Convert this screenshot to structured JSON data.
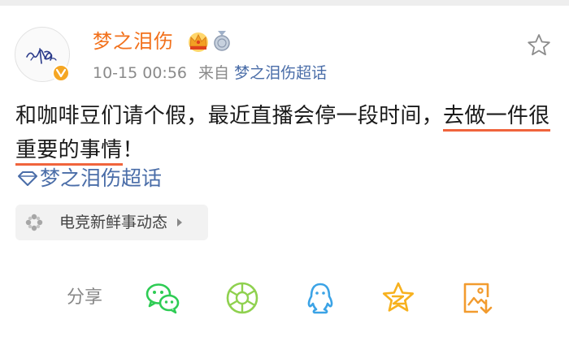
{
  "post": {
    "username": "梦之泪伤",
    "badges": [
      "crown-badge",
      "medal-badge"
    ],
    "timestamp": "10-15 00:56",
    "from_prefix": "来自",
    "from_source": "梦之泪伤超话",
    "content_before": "和咖啡豆们请个假，最近直播会停一段时间，",
    "content_highlight_1": "去做一件很",
    "content_highlight_2": "重要的事情",
    "content_after": "！",
    "topic_link": "梦之泪伤超话",
    "source_chip": {
      "label": "电竞新鲜事动态",
      "icon": "pinwheel-icon"
    }
  },
  "share": {
    "label": "分享",
    "targets": [
      {
        "name": "wechat-icon"
      },
      {
        "name": "moments-icon"
      },
      {
        "name": "qq-icon"
      },
      {
        "name": "qzone-icon"
      },
      {
        "name": "save-image-icon"
      }
    ]
  },
  "colors": {
    "username": "#f2711c",
    "link": "#4a6da8",
    "underline": "#f0643c",
    "meta": "#8a8a8a",
    "wechat": "#2ecc54",
    "moments": "#8fd14f",
    "qq": "#3ba3e6",
    "qzone": "#f7b11e",
    "save": "#f29b2e"
  }
}
